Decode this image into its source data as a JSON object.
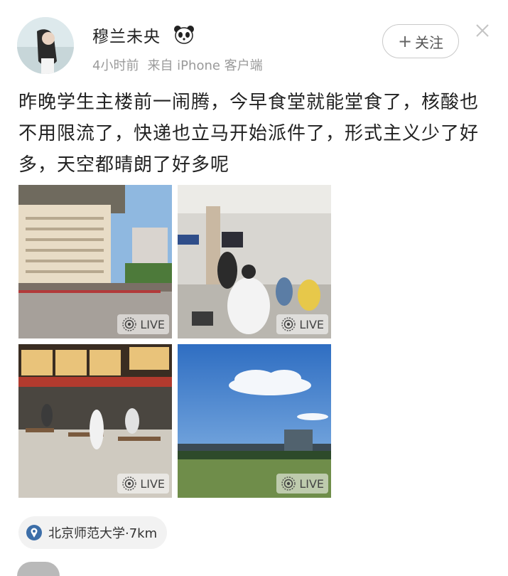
{
  "post": {
    "username": "穆兰未央",
    "time": "4小时前",
    "source": "来自 iPhone 客户端",
    "follow_label": "关注",
    "text": "昨晚学生主楼前一闹腾，今早食堂就能堂食了，核酸也不用限流了，快递也立马开始派件了，形式主义少了好多，天空都晴朗了好多呢",
    "photos": [
      {
        "live_label": "LIVE"
      },
      {
        "live_label": "LIVE"
      },
      {
        "live_label": "LIVE"
      },
      {
        "live_label": "LIVE"
      }
    ],
    "location": "北京师范大学·7km"
  },
  "colors": {
    "location_pin": "#3c6ea8",
    "meta_text": "#9a9a9a"
  },
  "icons": {
    "panda": "panda-icon",
    "close": "close-icon",
    "live": "live-icon",
    "location": "location-pin-icon"
  }
}
